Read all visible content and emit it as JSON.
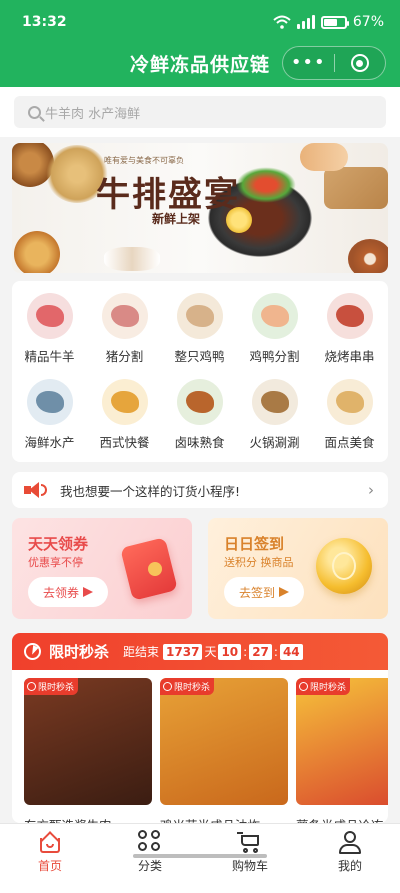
{
  "status_bar": {
    "time": "13:32",
    "battery": "67%",
    "battery_level": 0.67
  },
  "nav": {
    "title": "冷鲜冻品供应链",
    "more_glyph": "•••"
  },
  "search": {
    "placeholder": "牛羊肉 水产海鲜"
  },
  "banner": {
    "slogan": "唯有爱与美食不可辜负",
    "headline": "牛排盛宴",
    "subline": "新鲜上架"
  },
  "categories": [
    {
      "label": "精品牛羊",
      "color": "#e2676a"
    },
    {
      "label": "猪分割",
      "color": "#d98a86"
    },
    {
      "label": "整只鸡鸭",
      "color": "#d7b28a"
    },
    {
      "label": "鸡鸭分割",
      "color": "#f0b58e"
    },
    {
      "label": "烧烤串串",
      "color": "#c8503e"
    },
    {
      "label": "海鲜水产",
      "color": "#6f8fa8"
    },
    {
      "label": "西式快餐",
      "color": "#e6a53c"
    },
    {
      "label": "卤味熟食",
      "color": "#b9652c"
    },
    {
      "label": "火锅涮涮",
      "color": "#a97a45"
    },
    {
      "label": "面点美食",
      "color": "#e0b36a"
    }
  ],
  "notice": {
    "text": "我也想要一个这样的订货小程序!",
    "chevron": "›"
  },
  "promos": [
    {
      "title": "天天领券",
      "subtitle": "优惠享不停",
      "button": "去领券"
    },
    {
      "title": "日日签到",
      "subtitle": "送积分 换商品",
      "button": "去签到"
    }
  ],
  "flash_sale": {
    "title": "限时秒杀",
    "ends_label": "距结束",
    "days": "1737",
    "day_unit": "天",
    "hours": "10",
    "minutes": "27",
    "seconds": "44",
    "sep": ":",
    "tag": "限时秒杀",
    "products": [
      {
        "title": "东方甄选酱牛肉",
        "color_a": "#7a3a22",
        "color_b": "#3b1d12"
      },
      {
        "title": "鸡米花半成品油炸",
        "color_a": "#e8a237",
        "color_b": "#c9681c"
      },
      {
        "title": "薯条半成品冷冻",
        "color_a": "#f6c33b",
        "color_b": "#d8432d"
      }
    ]
  },
  "tabbar": [
    {
      "label": "首页",
      "active": true
    },
    {
      "label": "分类",
      "active": false
    },
    {
      "label": "购物车",
      "active": false
    },
    {
      "label": "我的",
      "active": false
    }
  ],
  "colors": {
    "primary": "#22b35e",
    "accent": "#e84b3c"
  }
}
